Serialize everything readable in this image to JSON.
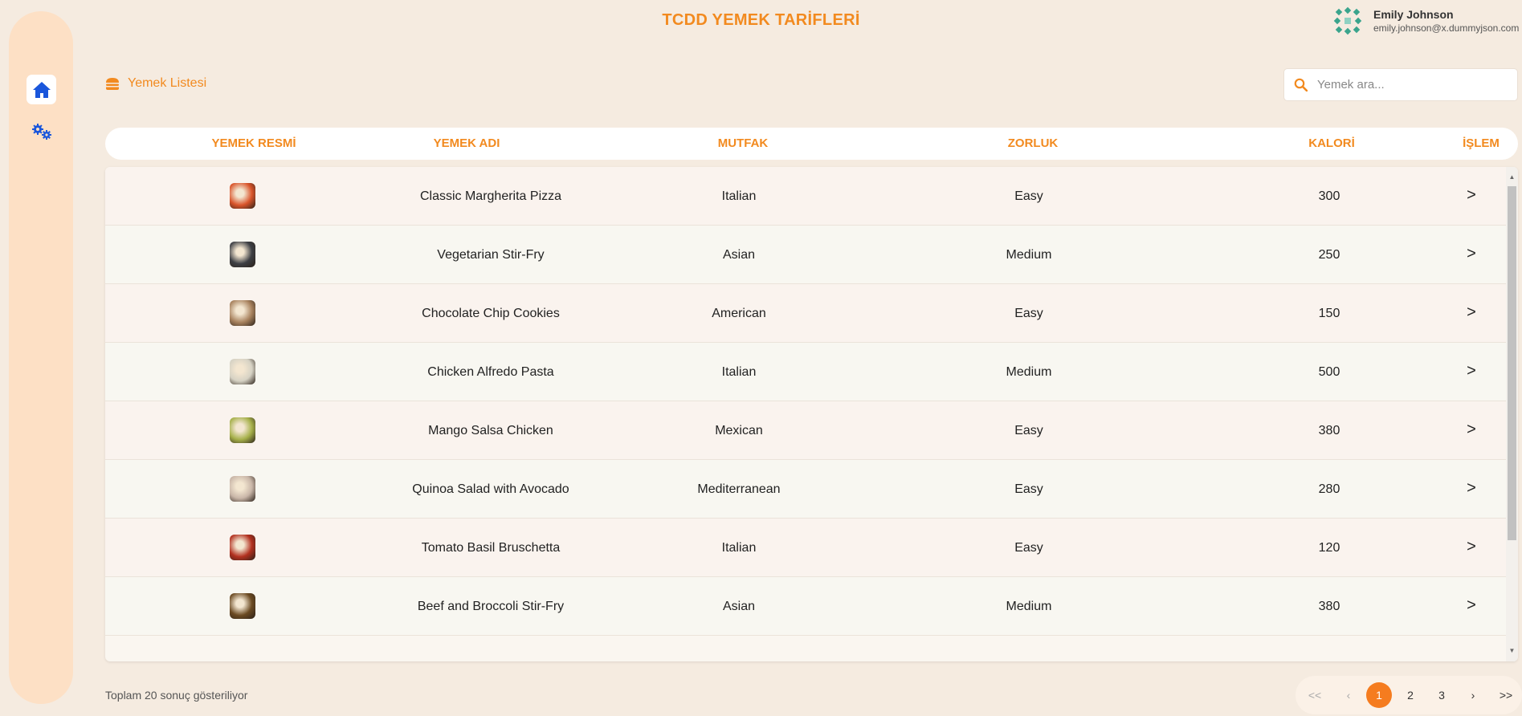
{
  "app": {
    "title": "TCDD YEMEK TARİFLERİ"
  },
  "user": {
    "name": "Emily Johnson",
    "email": "emily.johnson@x.dummyjson.com"
  },
  "sidebar": {
    "items": [
      {
        "icon": "home-icon",
        "active": true
      },
      {
        "icon": "gears-icon",
        "active": false
      }
    ]
  },
  "section": {
    "label": "Yemek Listesi",
    "icon": "burger-icon"
  },
  "search": {
    "placeholder": "Yemek ara...",
    "value": ""
  },
  "table": {
    "headers": {
      "image": "YEMEK RESMİ",
      "name": "YEMEK ADI",
      "cuisine": "MUTFAK",
      "difficulty": "ZORLUK",
      "calories": "KALORİ",
      "action": "İŞLEM"
    },
    "rows": [
      {
        "name": "Classic Margherita Pizza",
        "cuisine": "Italian",
        "difficulty": "Easy",
        "calories": "300",
        "action": ">",
        "thumb": "#d9542a"
      },
      {
        "name": "Vegetarian Stir-Fry",
        "cuisine": "Asian",
        "difficulty": "Medium",
        "calories": "250",
        "action": ">",
        "thumb": "#3d3f44"
      },
      {
        "name": "Chocolate Chip Cookies",
        "cuisine": "American",
        "difficulty": "Easy",
        "calories": "150",
        "action": ">",
        "thumb": "#a8825e"
      },
      {
        "name": "Chicken Alfredo Pasta",
        "cuisine": "Italian",
        "difficulty": "Medium",
        "calories": "500",
        "action": ">",
        "thumb": "#d6d2c4"
      },
      {
        "name": "Mango Salsa Chicken",
        "cuisine": "Mexican",
        "difficulty": "Easy",
        "calories": "380",
        "action": ">",
        "thumb": "#a6b04a"
      },
      {
        "name": "Quinoa Salad with Avocado",
        "cuisine": "Mediterranean",
        "difficulty": "Easy",
        "calories": "280",
        "action": ">",
        "thumb": "#c9b6a8"
      },
      {
        "name": "Tomato Basil Bruschetta",
        "cuisine": "Italian",
        "difficulty": "Easy",
        "calories": "120",
        "action": ">",
        "thumb": "#b2301f"
      },
      {
        "name": "Beef and Broccoli Stir-Fry",
        "cuisine": "Asian",
        "difficulty": "Medium",
        "calories": "380",
        "action": ">",
        "thumb": "#6b4a22"
      }
    ]
  },
  "footer": {
    "summary": "Toplam 20 sonuç gösteriliyor"
  },
  "pagination": {
    "first": "<<",
    "prev": "‹",
    "pages": [
      "1",
      "2",
      "3"
    ],
    "current": "1",
    "next": "›",
    "last": ">>"
  },
  "colors": {
    "accent": "#f28a1f",
    "active_page": "#f57c1f",
    "sidebar_bg": "#fde0c5",
    "icon_blue": "#1a56db"
  }
}
